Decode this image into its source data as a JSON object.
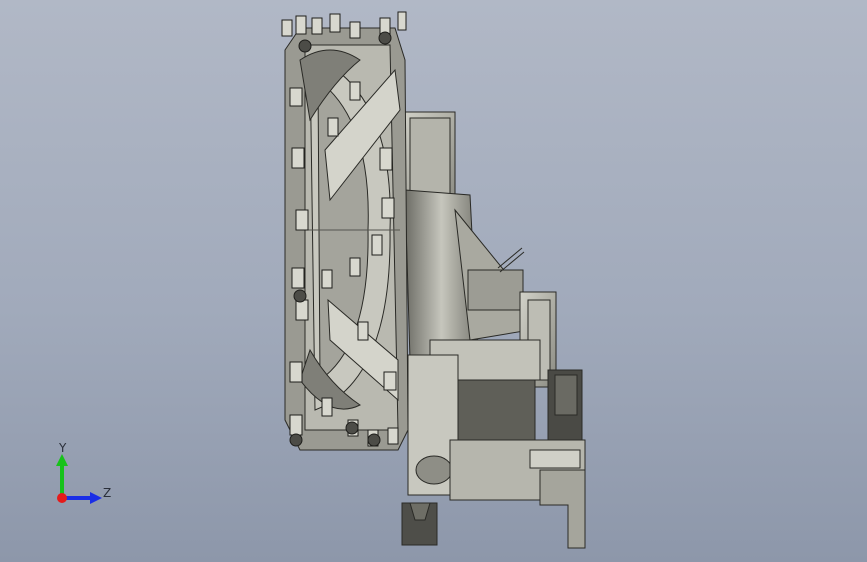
{
  "window": {
    "title": ""
  },
  "triad": {
    "y_label": "Y",
    "z_label": "Z",
    "colors": {
      "y": "#17c21a",
      "z": "#1a2ee6",
      "x": "#e51a1a"
    }
  },
  "viewport": {
    "background_top": "#b1b8c6",
    "background_bottom": "#8d97aa"
  },
  "model": {
    "icon": "cad-assembly-icon"
  }
}
